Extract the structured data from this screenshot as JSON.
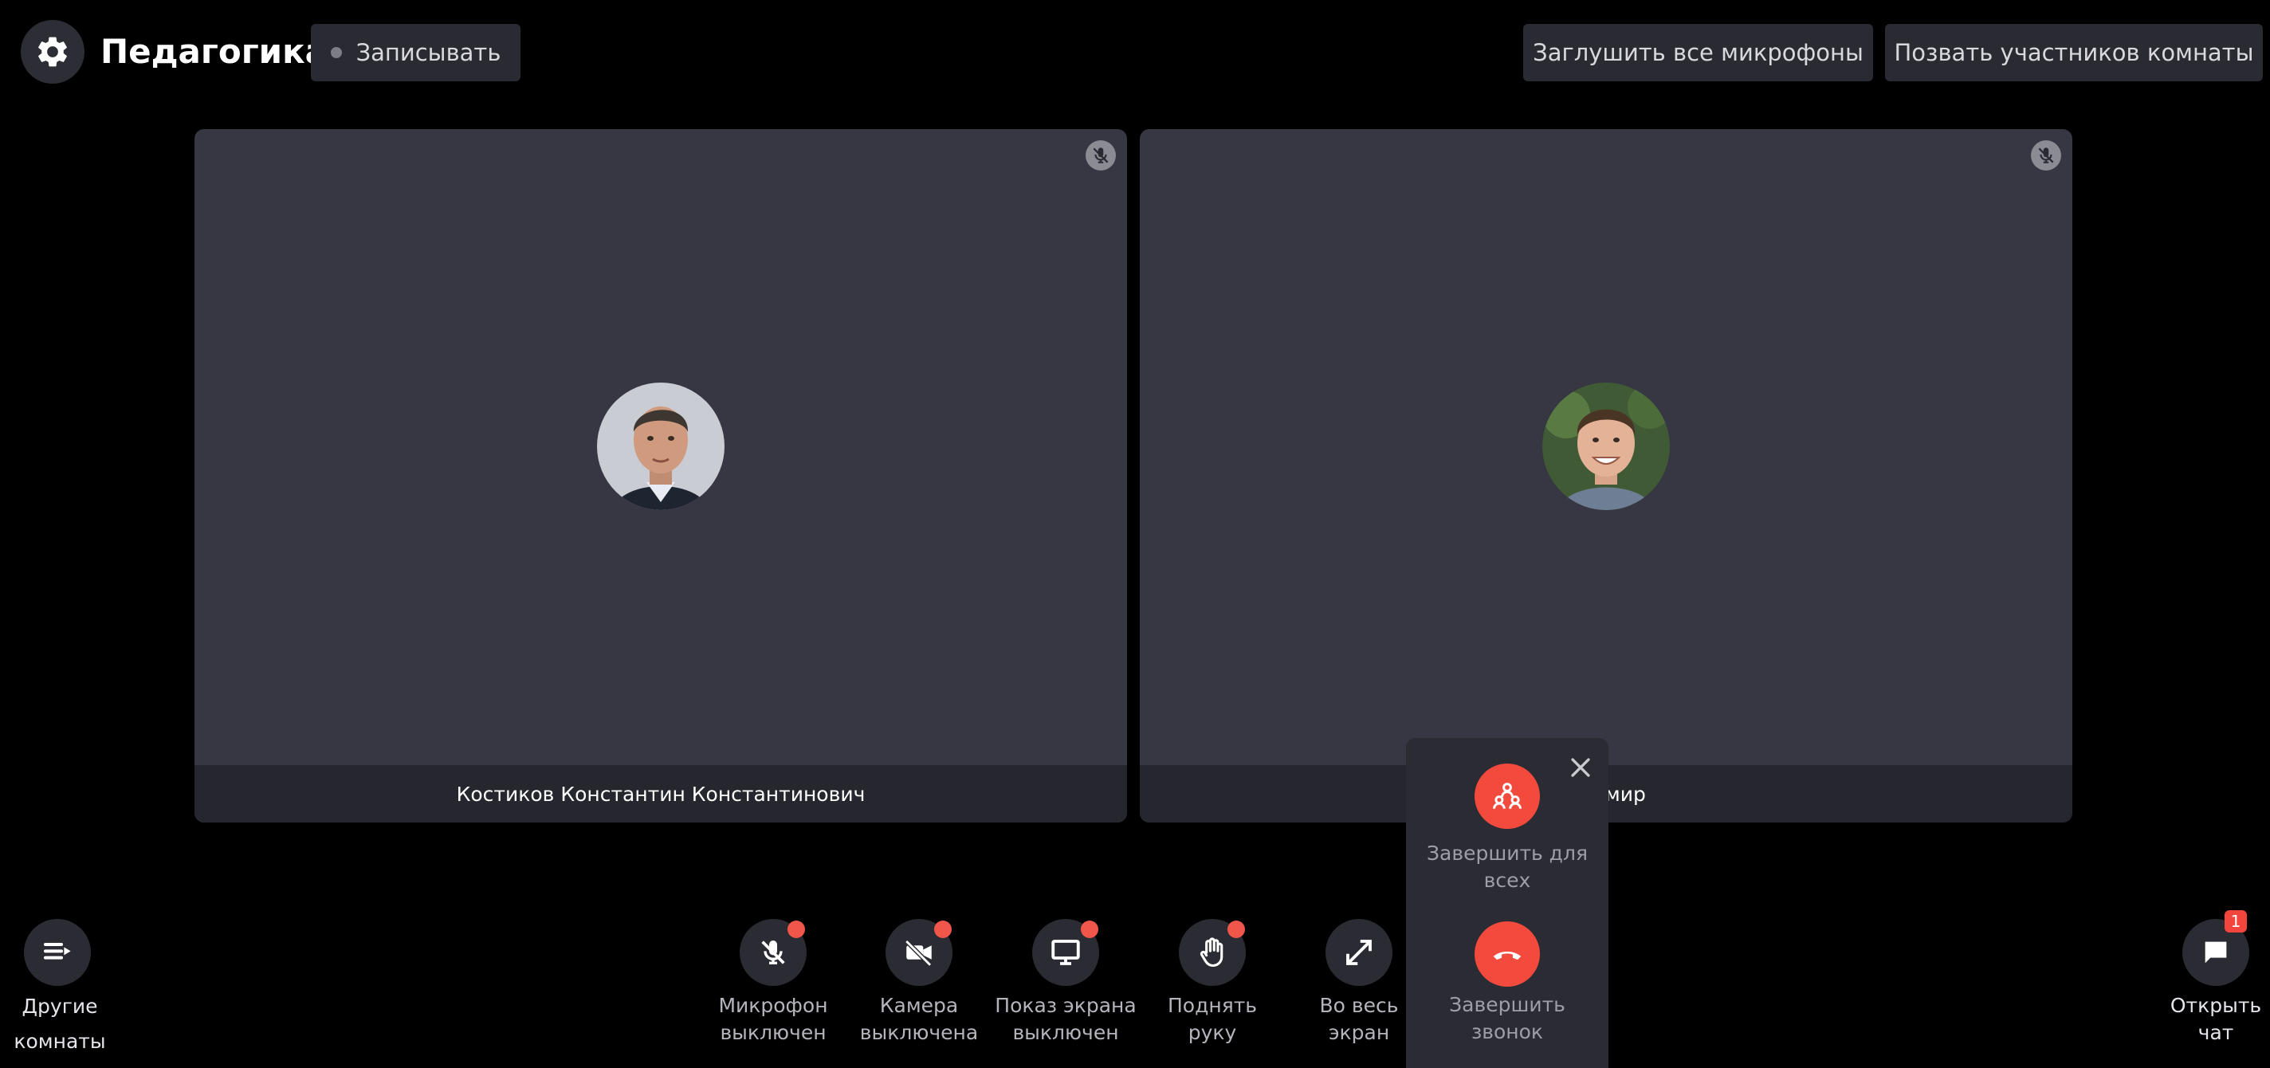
{
  "header": {
    "settings_icon": "gear-icon",
    "title": "Педагогика",
    "record_label": "Записывать",
    "mute_all_label": "Заглушить все микрофоны",
    "call_all_label": "Позвать участников комнаты"
  },
  "participants": [
    {
      "name": "Костиков Константин Константинович",
      "mic_state": "muted"
    },
    {
      "name": "адимир",
      "mic_state": "muted"
    }
  ],
  "controls": {
    "rooms": {
      "line1": "Другие",
      "line2": "комнаты"
    },
    "mic": {
      "line1": "Микрофон",
      "line2": "выключен"
    },
    "camera": {
      "line1": "Камера",
      "line2": "выключена"
    },
    "screen": {
      "line1": "Показ экрана",
      "line2": "выключен"
    },
    "hand": {
      "line1": "Поднять",
      "line2": "руку"
    },
    "fullscreen": {
      "line1": "Во весь",
      "line2": "экран"
    },
    "chat": {
      "line1": "Открыть",
      "line2": "чат",
      "badge": "1"
    }
  },
  "end_popup": {
    "end_for_all": {
      "line1": "Завершить для",
      "line2": "всех"
    },
    "end_call": {
      "line1": "Завершить",
      "line2": "звонок"
    }
  },
  "colors": {
    "background": "#000000",
    "tile": "#363742",
    "danger": "#f24b3e",
    "indicator": "#f0564a"
  }
}
